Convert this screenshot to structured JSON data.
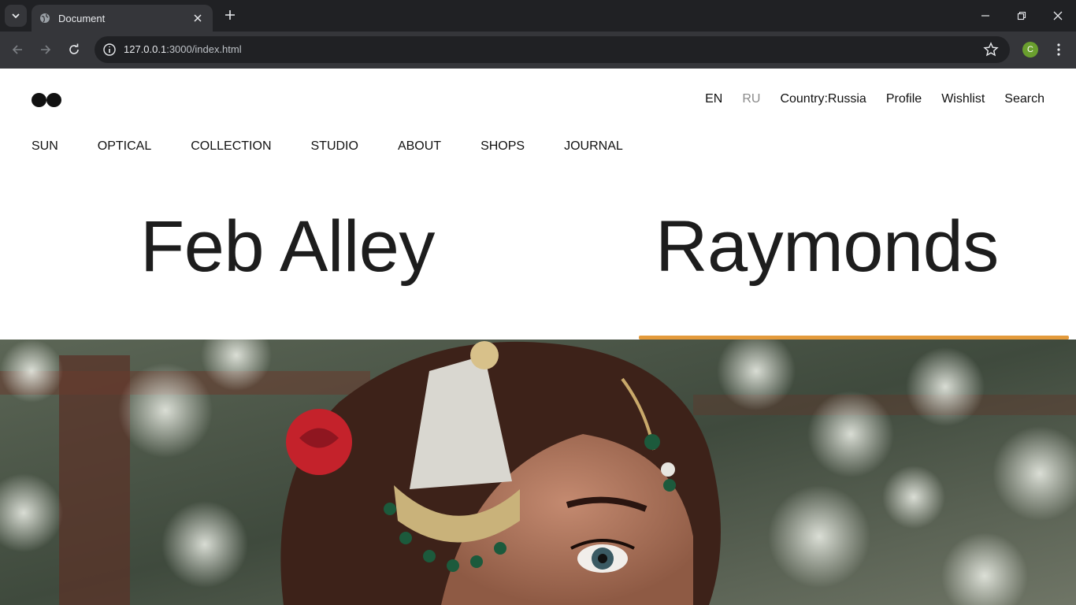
{
  "browser": {
    "tab_title": "Document",
    "url_host": "127.0.0.1",
    "url_path": ":3000/index.html",
    "profile_initial": "C"
  },
  "header": {
    "lang_en": "EN",
    "lang_ru": "RU",
    "country": "Country:Russia",
    "profile": "Profile",
    "wishlist": "Wishlist",
    "search": "Search"
  },
  "nav": {
    "items": [
      "SUN",
      "OPTICAL",
      "COLLECTION",
      "STUDIO",
      "ABOUT",
      "SHOPS",
      "JOURNAL"
    ]
  },
  "brands": {
    "left": "Feb Alley",
    "right": "Raymonds",
    "active_underline_color": "#e39a3b"
  },
  "hero": {
    "image": "woman-with-jewelry-headpiece-photo"
  }
}
